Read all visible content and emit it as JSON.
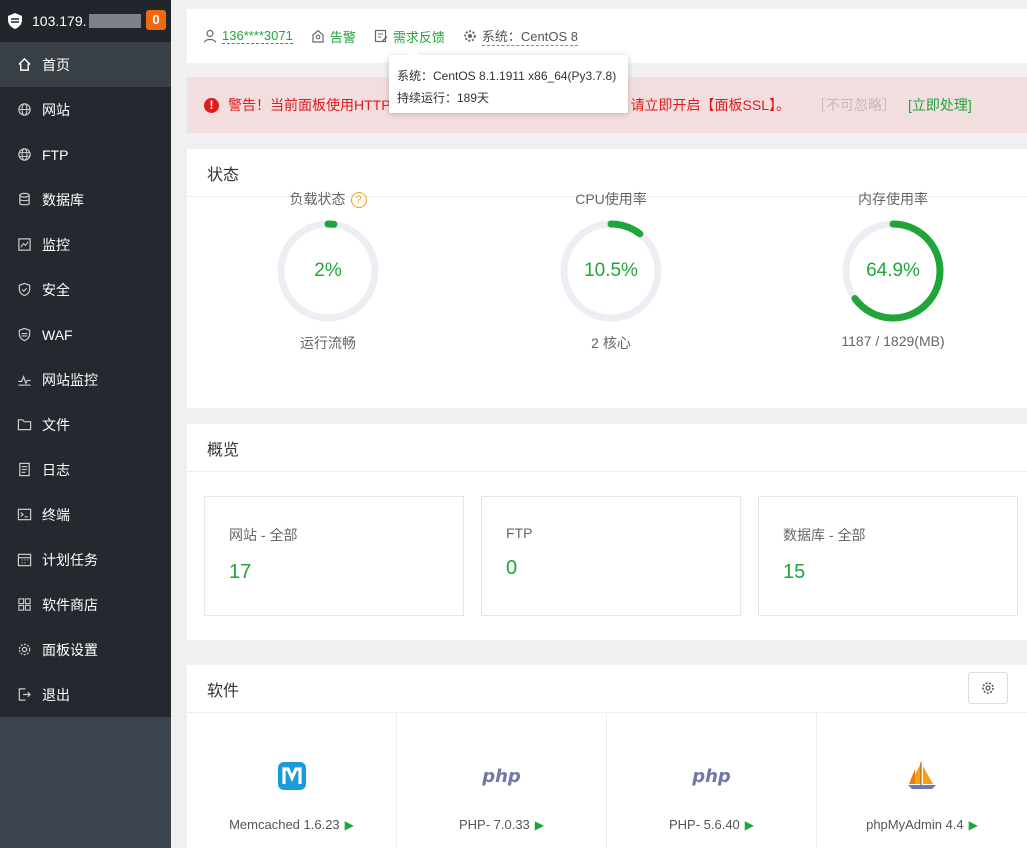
{
  "sidebar": {
    "ip_prefix": "103.179.",
    "badge": "0",
    "items": [
      {
        "label": "首页",
        "icon": "home-icon"
      },
      {
        "label": "网站",
        "icon": "globe-icon"
      },
      {
        "label": "FTP",
        "icon": "ftp-globe-icon"
      },
      {
        "label": "数据库",
        "icon": "database-icon"
      },
      {
        "label": "监控",
        "icon": "monitor-chart-icon"
      },
      {
        "label": "安全",
        "icon": "shield-check-icon"
      },
      {
        "label": "WAF",
        "icon": "waf-shield-icon"
      },
      {
        "label": "网站监控",
        "icon": "site-monitor-icon"
      },
      {
        "label": "文件",
        "icon": "folder-icon"
      },
      {
        "label": "日志",
        "icon": "log-file-icon"
      },
      {
        "label": "终端",
        "icon": "terminal-icon"
      },
      {
        "label": "计划任务",
        "icon": "calendar-icon"
      },
      {
        "label": "软件商店",
        "icon": "apps-grid-icon"
      },
      {
        "label": "面板设置",
        "icon": "settings-icon"
      },
      {
        "label": "退出",
        "icon": "logout-icon"
      }
    ]
  },
  "topbar": {
    "user": "136****3071",
    "alarm": "告警",
    "feedback": "需求反馈",
    "system": "系统：CentOS 8"
  },
  "tooltip": {
    "line1": "系统：CentOS 8.1.1911 x86_64(Py3.7.8)",
    "line2": "持续运行：189天"
  },
  "alert": {
    "icon": "!",
    "text_start": "警告！当前面板使用HTTP",
    "text_end": "请立即开启【面板SSL】。",
    "ignore": "［不可忽略］",
    "action": "[立即处理]"
  },
  "status": {
    "title": "状态",
    "help_icon_text": "?",
    "gauges": [
      {
        "title": "负载状态",
        "value": "2%",
        "percent": 2,
        "sub": "运行流畅",
        "has_help": true
      },
      {
        "title": "CPU使用率",
        "value": "10.5%",
        "percent": 10.5,
        "sub": "2 核心",
        "has_help": false
      },
      {
        "title": "内存使用率",
        "value": "64.9%",
        "percent": 64.9,
        "sub": "1187 / 1829(MB)",
        "has_help": false
      }
    ]
  },
  "overview": {
    "title": "概览",
    "cards": [
      {
        "label": "网站 - 全部",
        "value": "17"
      },
      {
        "label": "FTP",
        "value": "0"
      },
      {
        "label": "数据库 - 全部",
        "value": "15"
      }
    ]
  },
  "software": {
    "title": "软件",
    "items": [
      {
        "name": "Memcached 1.6.23",
        "logo": "memcached-logo",
        "logo_text": "M"
      },
      {
        "name": "PHP- 7.0.33",
        "logo": "php-logo",
        "logo_text": "php"
      },
      {
        "name": "PHP- 5.6.40",
        "logo": "php-logo",
        "logo_text": "php"
      },
      {
        "name": "phpMyAdmin 4.4",
        "logo": "phpmyadmin-logo",
        "logo_text": ""
      }
    ],
    "play_symbol": "▶"
  },
  "colors": {
    "accent": "#20a53a",
    "sidebar_bg": "#3c444d",
    "alert_bg": "#f2dede",
    "alert_text": "#e01b1b",
    "badge": "#f0690a",
    "gauge_track": "#eceef3"
  }
}
